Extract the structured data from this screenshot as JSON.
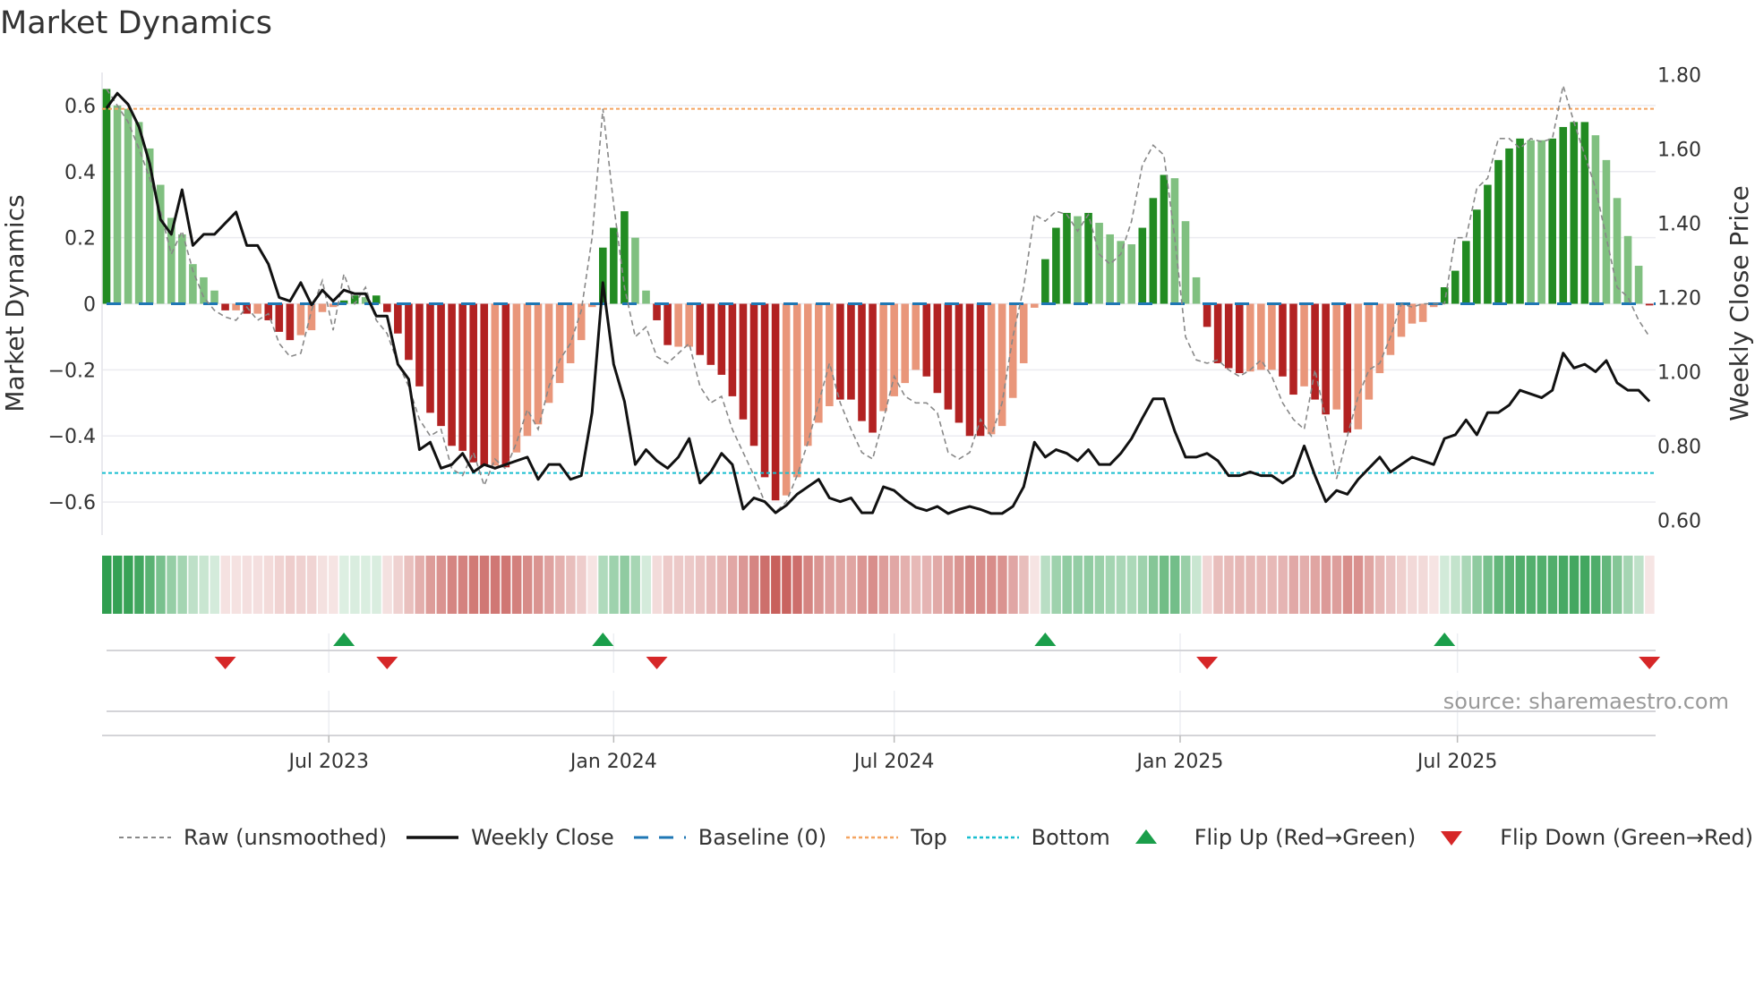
{
  "title": "Market Dynamics",
  "source": "source: sharemaestro.com",
  "legend": [
    {
      "key": "raw",
      "label": "Raw (unsmoothed)"
    },
    {
      "key": "close",
      "label": "Weekly Close"
    },
    {
      "key": "baseline",
      "label": "Baseline (0)"
    },
    {
      "key": "top",
      "label": "Top"
    },
    {
      "key": "bottom",
      "label": "Bottom"
    },
    {
      "key": "flipup",
      "label": "Flip Up (Red→Green)"
    },
    {
      "key": "flipdown",
      "label": "Flip Down (Green→Red)"
    }
  ],
  "colors": {
    "dark_green": "#228b22",
    "light_green": "#80c080",
    "dark_red": "#b22222",
    "light_red": "#e9967a",
    "raw": "#888888",
    "close": "#111111",
    "baseline": "#1f77b4",
    "top": "#f4a460",
    "bottom": "#17becf",
    "flip_up": "#1a9e4a",
    "flip_down": "#d62728",
    "heat_green": "#2f9e4f",
    "heat_red": "#c65a56"
  },
  "chart_data": {
    "type": "bar",
    "title": "Market Dynamics",
    "ylabel": "Market Dynamics",
    "ylabel_right": "Weekly Close Price",
    "ylim": [
      -0.7,
      0.7
    ],
    "ylim_right": [
      0.56,
      1.806
    ],
    "y_ticks": [
      {
        "v": 0.6,
        "label": "0.6"
      },
      {
        "v": 0.4,
        "label": "0.4"
      },
      {
        "v": 0.2,
        "label": "0.2"
      },
      {
        "v": 0,
        "label": "0"
      },
      {
        "v": -0.2,
        "label": "−0.2"
      },
      {
        "v": -0.4,
        "label": "−0.4"
      },
      {
        "v": -0.6,
        "label": "−0.6"
      }
    ],
    "y_right_ticks": [
      {
        "v": 1.8,
        "label": "1.80"
      },
      {
        "v": 1.6,
        "label": "1.60"
      },
      {
        "v": 1.4,
        "label": "1.40"
      },
      {
        "v": 1.2,
        "label": "1.20"
      },
      {
        "v": 1.0,
        "label": "1.00"
      },
      {
        "v": 0.8,
        "label": "0.80"
      },
      {
        "v": 0.6,
        "label": "0.60"
      }
    ],
    "x_ticks": [
      {
        "week": 20.6,
        "label": "Jul 2023"
      },
      {
        "week": 47.0,
        "label": "Jan 2024"
      },
      {
        "week": 73.0,
        "label": "Jul 2024"
      },
      {
        "week": 99.5,
        "label": "Jan 2025"
      },
      {
        "week": 125.2,
        "label": "Jul 2025"
      }
    ],
    "top_level": 0.59,
    "bottom_level": -0.512,
    "baseline": 0,
    "grid": true,
    "legend_position": "bottom",
    "values": [
      0.65,
      0.6,
      0.59,
      0.55,
      0.47,
      0.36,
      0.26,
      0.21,
      0.12,
      0.08,
      0.04,
      -0.02,
      -0.02,
      -0.03,
      -0.03,
      -0.05,
      -0.085,
      -0.11,
      -0.095,
      -0.08,
      -0.025,
      -0.01,
      0.01,
      0.025,
      0.02,
      0.025,
      -0.025,
      -0.09,
      -0.17,
      -0.25,
      -0.33,
      -0.37,
      -0.43,
      -0.445,
      -0.48,
      -0.49,
      -0.49,
      -0.495,
      -0.45,
      -0.4,
      -0.365,
      -0.3,
      -0.24,
      -0.18,
      -0.11,
      -0.01,
      0.17,
      0.23,
      0.28,
      0.2,
      0.04,
      -0.05,
      -0.125,
      -0.13,
      -0.13,
      -0.155,
      -0.185,
      -0.215,
      -0.28,
      -0.35,
      -0.43,
      -0.525,
      -0.595,
      -0.58,
      -0.525,
      -0.43,
      -0.36,
      -0.31,
      -0.29,
      -0.29,
      -0.355,
      -0.39,
      -0.325,
      -0.28,
      -0.24,
      -0.2,
      -0.22,
      -0.27,
      -0.32,
      -0.36,
      -0.4,
      -0.4,
      -0.395,
      -0.37,
      -0.285,
      -0.18,
      -0.012,
      0.135,
      0.23,
      0.275,
      0.265,
      0.275,
      0.245,
      0.21,
      0.19,
      0.18,
      0.23,
      0.32,
      0.39,
      0.38,
      0.25,
      0.08,
      -0.07,
      -0.18,
      -0.195,
      -0.21,
      -0.205,
      -0.2,
      -0.2,
      -0.22,
      -0.275,
      -0.25,
      -0.29,
      -0.335,
      -0.32,
      -0.39,
      -0.38,
      -0.29,
      -0.21,
      -0.155,
      -0.1,
      -0.06,
      -0.055,
      -0.01,
      0.05,
      0.1,
      0.19,
      0.285,
      0.36,
      0.435,
      0.47,
      0.5,
      0.495,
      0.495,
      0.5,
      0.535,
      0.55,
      0.55,
      0.51,
      0.435,
      0.32,
      0.205,
      0.115,
      -0.005
    ],
    "shade": "DLLLLLLLLLLDLDLDDDLLLLDDLDDDDDDDDDDDLDLLLLLLLLDDDLLDDLLDDDDDDDDLLLLLDDDDLLLLDDDDDDLLLLLDDDLDLLLLDDDLLLDDDDLLLDDLDDLDLLLLLLLLDDDDDDDDLLDDDDLLLLLD",
    "raw": [
      0.65,
      0.6,
      0.55,
      0.47,
      0.38,
      0.28,
      0.15,
      0.22,
      0.1,
      0.02,
      -0.02,
      -0.04,
      -0.05,
      -0.01,
      -0.05,
      -0.03,
      -0.12,
      -0.16,
      -0.15,
      -0.02,
      0.07,
      -0.08,
      0.09,
      0.0,
      0.05,
      -0.05,
      -0.09,
      -0.18,
      -0.25,
      -0.35,
      -0.4,
      -0.38,
      -0.5,
      -0.52,
      -0.45,
      -0.55,
      -0.47,
      -0.5,
      -0.42,
      -0.32,
      -0.38,
      -0.25,
      -0.17,
      -0.12,
      -0.02,
      0.2,
      0.59,
      0.3,
      0.05,
      -0.1,
      -0.07,
      -0.16,
      -0.18,
      -0.15,
      -0.12,
      -0.25,
      -0.3,
      -0.28,
      -0.38,
      -0.45,
      -0.52,
      -0.6,
      -0.63,
      -0.6,
      -0.52,
      -0.42,
      -0.3,
      -0.18,
      -0.3,
      -0.38,
      -0.45,
      -0.47,
      -0.35,
      -0.22,
      -0.28,
      -0.3,
      -0.3,
      -0.33,
      -0.45,
      -0.47,
      -0.45,
      -0.35,
      -0.4,
      -0.3,
      -0.1,
      0.05,
      0.27,
      0.25,
      0.28,
      0.27,
      0.22,
      0.27,
      0.15,
      0.12,
      0.15,
      0.25,
      0.42,
      0.48,
      0.45,
      0.2,
      -0.1,
      -0.17,
      -0.18,
      -0.17,
      -0.2,
      -0.22,
      -0.2,
      -0.17,
      -0.22,
      -0.3,
      -0.35,
      -0.38,
      -0.2,
      -0.35,
      -0.53,
      -0.4,
      -0.28,
      -0.2,
      -0.18,
      -0.1,
      0.0,
      -0.01,
      0.0,
      0.0,
      0.0,
      0.2,
      0.2,
      0.35,
      0.38,
      0.5,
      0.5,
      0.47,
      0.5,
      0.49,
      0.5,
      0.66,
      0.55,
      0.45,
      0.35,
      0.2,
      0.05,
      0.02,
      -0.05,
      -0.1
    ],
    "close": [
      1.71,
      1.75,
      1.72,
      1.66,
      1.56,
      1.41,
      1.37,
      1.49,
      1.34,
      1.37,
      1.37,
      1.4,
      1.43,
      1.34,
      1.34,
      1.29,
      1.2,
      1.19,
      1.24,
      1.18,
      1.22,
      1.19,
      1.22,
      1.21,
      1.21,
      1.15,
      1.15,
      1.02,
      0.98,
      0.79,
      0.81,
      0.74,
      0.75,
      0.78,
      0.73,
      0.75,
      0.74,
      0.75,
      0.76,
      0.77,
      0.71,
      0.75,
      0.75,
      0.71,
      0.72,
      0.89,
      1.24,
      1.02,
      0.92,
      0.75,
      0.79,
      0.76,
      0.74,
      0.77,
      0.82,
      0.7,
      0.73,
      0.78,
      0.75,
      0.63,
      0.66,
      0.65,
      0.62,
      0.64,
      0.67,
      0.69,
      0.71,
      0.66,
      0.65,
      0.66,
      0.62,
      0.62,
      0.69,
      0.68,
      0.655,
      0.635,
      0.626,
      0.637,
      0.618,
      0.629,
      0.637,
      0.629,
      0.618,
      0.618,
      0.637,
      0.69,
      0.81,
      0.77,
      0.79,
      0.78,
      0.76,
      0.79,
      0.75,
      0.75,
      0.78,
      0.82,
      0.875,
      0.927,
      0.927,
      0.84,
      0.77,
      0.77,
      0.78,
      0.76,
      0.72,
      0.72,
      0.73,
      0.72,
      0.72,
      0.7,
      0.72,
      0.8,
      0.72,
      0.65,
      0.68,
      0.67,
      0.71,
      0.74,
      0.77,
      0.73,
      0.75,
      0.77,
      0.76,
      0.75,
      0.82,
      0.83,
      0.87,
      0.83,
      0.89,
      0.89,
      0.91,
      0.95,
      0.94,
      0.93,
      0.95,
      1.05,
      1.01,
      1.02,
      1.0,
      1.03,
      0.97,
      0.95,
      0.95,
      0.92
    ],
    "flip_up_weeks": [
      22,
      46,
      87,
      124
    ],
    "flip_down_weeks": [
      11,
      26,
      51,
      102,
      143
    ]
  }
}
